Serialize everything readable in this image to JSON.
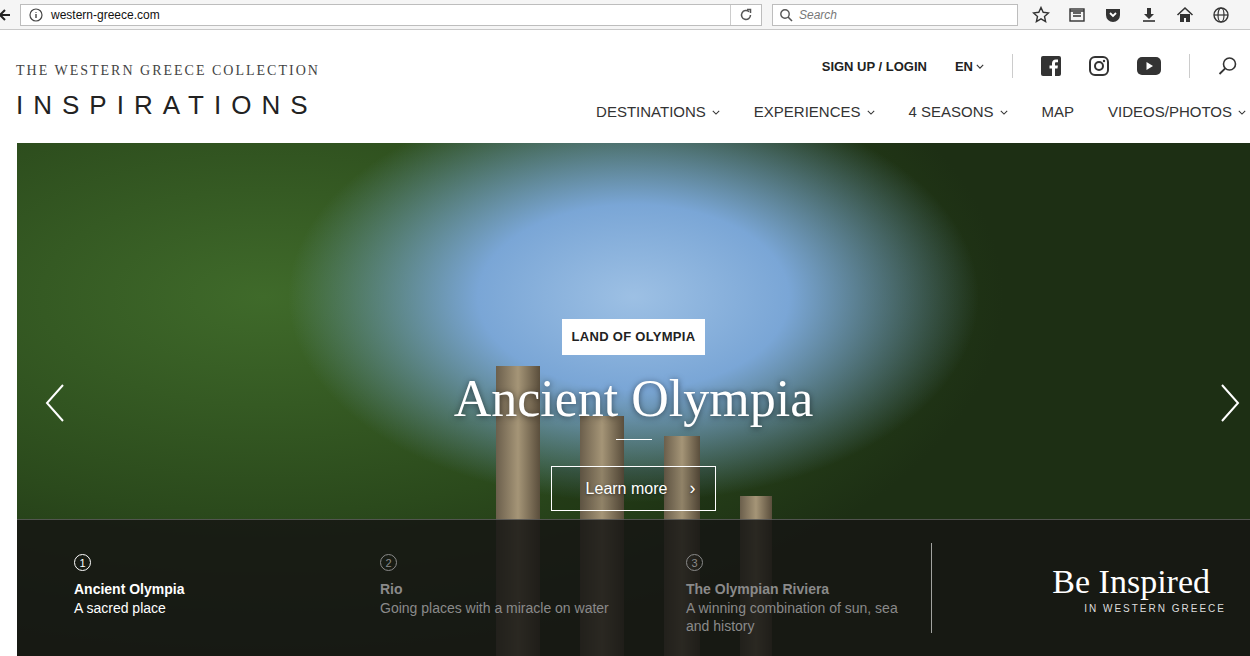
{
  "browser": {
    "address": "western-greece.com",
    "search_placeholder": "Search"
  },
  "logo": {
    "line1": "THE WESTERN GREECE COLLECTION",
    "line2": "INSPIRATIONS"
  },
  "top_links": {
    "login": "SIGN UP / LOGIN",
    "language": "EN"
  },
  "nav": [
    {
      "label": "DESTINATIONS",
      "dropdown": true
    },
    {
      "label": "EXPERIENCES",
      "dropdown": true
    },
    {
      "label": "4 SEASONS",
      "dropdown": true
    },
    {
      "label": "MAP",
      "dropdown": false
    },
    {
      "label": "VIDEOS/PHOTOS",
      "dropdown": true
    }
  ],
  "hero": {
    "tag": "LAND OF OLYMPIA",
    "title": "Ancient Olympia",
    "button": "Learn more",
    "button_icon": "›"
  },
  "slides": [
    {
      "number": "1",
      "title": "Ancient Olympia",
      "subtitle": "A sacred place",
      "selected": true
    },
    {
      "number": "2",
      "title": "Rio",
      "subtitle": "Going places with a miracle on water",
      "selected": false
    },
    {
      "number": "3",
      "title": "The Olympian Riviera",
      "subtitle": "A winning combination of sun, sea and history",
      "selected": false
    }
  ],
  "tagline": {
    "title": "Be Inspired",
    "subtitle": "IN WESTERN GREECE"
  }
}
